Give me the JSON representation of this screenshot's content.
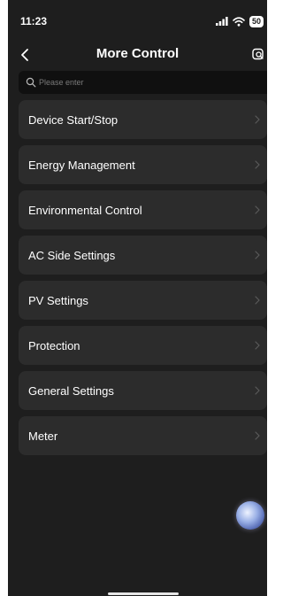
{
  "status_bar": {
    "time": "11:23",
    "battery": "50",
    "icons": [
      "signal-icon",
      "wifi-icon",
      "battery-icon"
    ]
  },
  "header": {
    "title": "More Control",
    "back_icon": "chevron-left-icon",
    "action_icon": "settings-search-icon"
  },
  "search": {
    "placeholder": "Please enter",
    "value": ""
  },
  "menu": {
    "items": [
      {
        "label": "Device Start/Stop"
      },
      {
        "label": "Energy Management"
      },
      {
        "label": "Environmental Control"
      },
      {
        "label": "AC Side Settings"
      },
      {
        "label": "PV Settings"
      },
      {
        "label": "Protection"
      },
      {
        "label": "General Settings"
      },
      {
        "label": "Meter"
      }
    ]
  },
  "colors": {
    "background": "#1e1e1e",
    "card": "#2c2c2c",
    "search_bg": "#101010",
    "text": "#ffffff",
    "placeholder": "#7a7a7a",
    "chevron": "#5a5a5a"
  }
}
